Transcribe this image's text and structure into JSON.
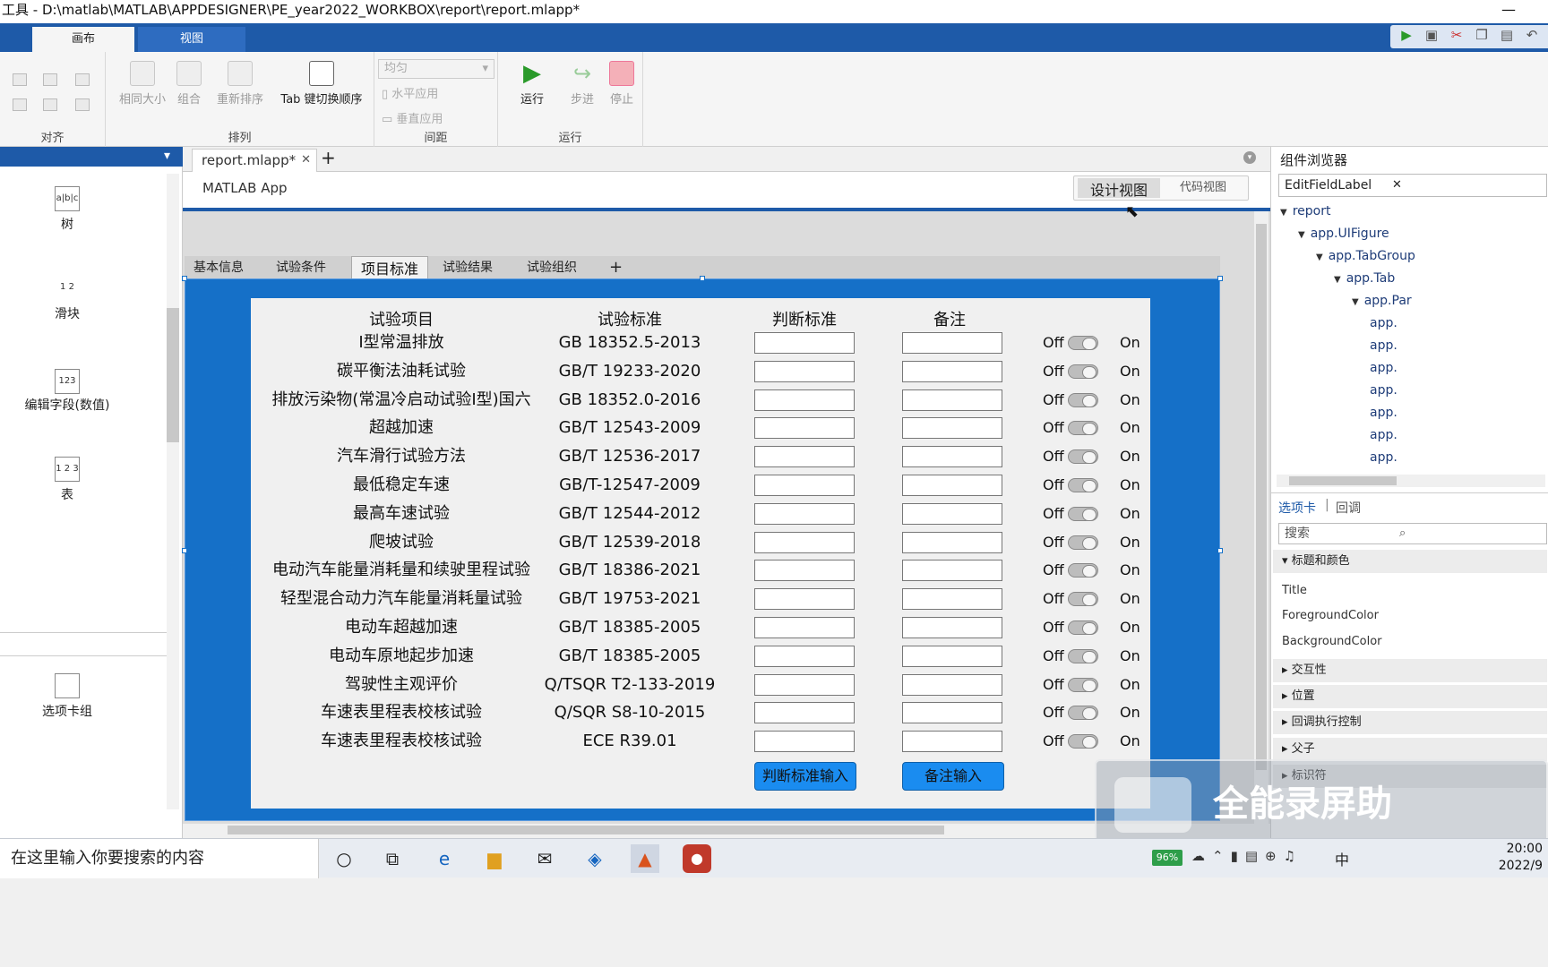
{
  "window": {
    "title": "工具 - D:\\matlab\\MATLAB\\APPDESIGNER\\PE_year2022_WORKBOX\\report\\report.mlapp*",
    "minimize": "—"
  },
  "ribbon_tabs": [
    "画布",
    "视图"
  ],
  "ribbon": {
    "sections": {
      "align": "对齐",
      "arrange": "排列",
      "spacing": "间距",
      "run": "运行"
    },
    "same_size": "相同大小",
    "group": "组合",
    "reorder": "重新排序",
    "tab_order": "Tab 键切换顺序",
    "spacing_select": "均匀",
    "horizontal_apply": "水平应用",
    "vertical_apply": "垂直应用",
    "run": "运行",
    "step": "步进",
    "stop": "停止"
  },
  "components": [
    {
      "label": "树",
      "icon": "tree-icon"
    },
    {
      "label": "滑块",
      "icon": "slider-icon"
    },
    {
      "label": "编辑字段(数值)",
      "icon": "numeric-field-icon"
    },
    {
      "label": "表",
      "icon": "table-icon"
    },
    {
      "label": "选项卡组",
      "icon": "tabgroup-icon"
    }
  ],
  "component_icon_text": {
    "tree": "a|b|c",
    "slider": "1 2",
    "numeric": "123",
    "table": "1 2 3"
  },
  "document": {
    "tab": "report.mlapp*",
    "app_title": "MATLAB App",
    "design_view": "设计视图",
    "code_view": "代码视图"
  },
  "form": {
    "tabs": [
      "基本信息",
      "试验条件",
      "项目标准",
      "试验结果",
      "试验组织"
    ],
    "active_tab": "项目标准",
    "headers": {
      "item": "试验项目",
      "standard": "试验标准",
      "criterion": "判断标准",
      "note": "备注"
    },
    "switch_off": "Off",
    "switch_on": "On",
    "rows": [
      {
        "item": "Ⅰ型常温排放",
        "standard": "GB 18352.5-2013"
      },
      {
        "item": "碳平衡法油耗试验",
        "standard": "GB/T 19233-2020"
      },
      {
        "item": "排放污染物(常温冷启动试验Ⅰ型)国六",
        "standard": "GB 18352.0-2016"
      },
      {
        "item": "超越加速",
        "standard": "GB/T 12543-2009"
      },
      {
        "item": "汽车滑行试验方法",
        "standard": "GB/T 12536-2017"
      },
      {
        "item": "最低稳定车速",
        "standard": "GB/T-12547-2009"
      },
      {
        "item": "最高车速试验",
        "standard": "GB/T 12544-2012"
      },
      {
        "item": "爬坡试验",
        "standard": "GB/T 12539-2018"
      },
      {
        "item": "电动汽车能量消耗量和续驶里程试验",
        "standard": "GB/T 18386-2021"
      },
      {
        "item": "轻型混合动力汽车能量消耗量试验",
        "standard": "GB/T 19753-2021"
      },
      {
        "item": "电动车超越加速",
        "standard": "GB/T 18385-2005"
      },
      {
        "item": "电动车原地起步加速",
        "standard": "GB/T 18385-2005"
      },
      {
        "item": "驾驶性主观评价",
        "standard": "Q/TSQR T2-133-2019"
      },
      {
        "item": "车速表里程表校核试验",
        "standard": "Q/SQR S8-10-2015"
      },
      {
        "item": "车速表里程表校核试验",
        "standard": "ECE R39.01"
      }
    ],
    "btn_criterion": "判断标准输入",
    "btn_note": "备注输入"
  },
  "browser": {
    "title": "组件浏览器",
    "search_value": "EditFieldLabel",
    "tree": [
      {
        "label": "report",
        "depth": 0
      },
      {
        "label": "app.UIFigure",
        "depth": 1
      },
      {
        "label": "app.TabGroup",
        "depth": 2
      },
      {
        "label": "app.Tab",
        "depth": 3
      },
      {
        "label": "app.Par",
        "depth": 4
      },
      {
        "label": "app.",
        "depth": 5
      },
      {
        "label": "app.",
        "depth": 5
      },
      {
        "label": "app.",
        "depth": 5
      },
      {
        "label": "app.",
        "depth": 5
      },
      {
        "label": "app.",
        "depth": 5
      },
      {
        "label": "app.",
        "depth": 5
      },
      {
        "label": "app.",
        "depth": 5
      }
    ],
    "tabs": [
      "选项卡",
      "回调"
    ],
    "prop_search_placeholder": "搜索",
    "sections": [
      "标题和颜色",
      "交互性",
      "位置",
      "回调执行控制",
      "父子",
      "标识符"
    ],
    "props": [
      "Title",
      "ForegroundColor",
      "BackgroundColor"
    ]
  },
  "taskbar": {
    "search_placeholder": "在这里输入你要搜索的内容",
    "time": "20:00",
    "date": "2022/9",
    "battery": "96%",
    "ime": "中"
  },
  "watermark": "全能录屏助",
  "colors": {
    "accent": "#1e5aa8",
    "panel_blue": "#1570c8",
    "button_blue": "#1a8cf0"
  }
}
